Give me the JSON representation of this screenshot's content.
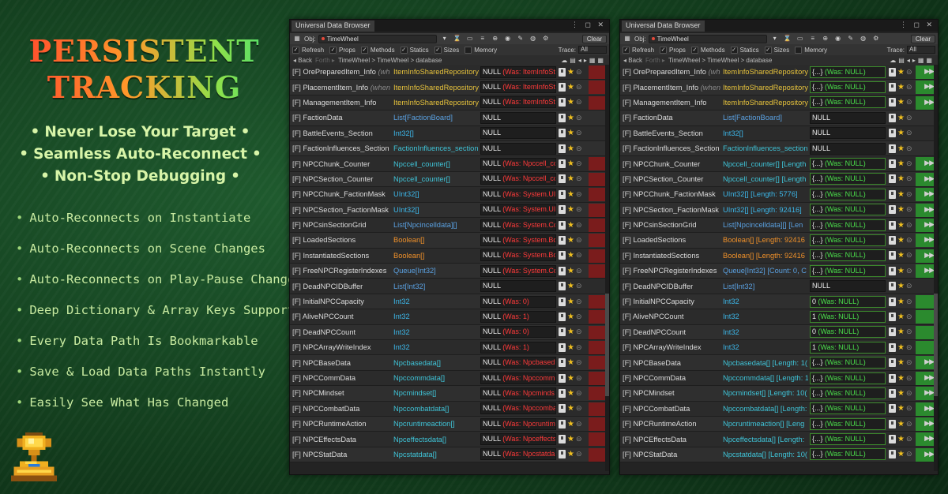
{
  "promo": {
    "title_line1": "PERSISTENT",
    "title_line2": "TRACKING",
    "taglines": [
      "Never Lose Your Target",
      "Seamless Auto-Reconnect",
      "Non-Stop Debugging"
    ],
    "tagline_bullet": "•",
    "features": [
      "Auto-Reconnects on Instantiate",
      "Auto-Reconnects on Scene Changes",
      "Auto-Reconnects on Play-Pause Changes",
      "Deep Dictionary & Array Keys Support",
      "Every Data Path Is Bookmarkable",
      "Save & Load Data Paths Instantly",
      "Easily See What Has Changed"
    ],
    "feature_bullet": "•"
  },
  "window": {
    "tab_title": "Universal Data Browser",
    "obj_label": "Obj:",
    "obj_value": "TimeWheel",
    "clear_label": "Clear",
    "options": [
      "Refresh",
      "Props",
      "Methods",
      "Statics",
      "Sizes",
      "Memory"
    ],
    "options_checked": [
      true,
      true,
      true,
      true,
      true,
      false
    ],
    "trace_label": "Trace:",
    "trace_value": "All",
    "back_label": "◂ Back",
    "forward_label": "Forth ▸",
    "breadcrumb": [
      "TimeWheel",
      "TimeWheel",
      "database"
    ],
    "breadcrumb_sep": ">"
  },
  "colors": {
    "was_red": "#ff3a3a",
    "was_green": "#4be04b",
    "highlight_red": "#7a1c1c",
    "highlight_green": "#2b8a2e"
  },
  "left_rows": [
    {
      "f": "[F]",
      "name": "OrePreparedItem_Info",
      "hint": "(wh",
      "type": "ItemInfoSharedRepository",
      "tc": "t-yellow",
      "val": "NULL",
      "was": "(Was: ItemInfoSt",
      "hl": true
    },
    {
      "f": "[F]",
      "name": "PlacementItem_Info",
      "hint": "(when",
      "type": "ItemInfoSharedRepository",
      "tc": "t-yellow",
      "val": "NULL",
      "was": "(Was: ItemInfoSt",
      "hl": true
    },
    {
      "f": "[F]",
      "name": "ManagementItem_Info",
      "hint": "",
      "type": "ItemInfoSharedRepository",
      "tc": "t-yellow",
      "val": "NULL",
      "was": "(Was: ItemInfoSt",
      "hl": true
    },
    {
      "f": "[F]",
      "name": "FactionData",
      "hint": "",
      "type": "List[FactionBoard]",
      "tc": "t-blue",
      "val": "NULL",
      "was": "",
      "hl": false
    },
    {
      "f": "[F]",
      "name": "BattleEvents_Section",
      "hint": "",
      "type": "Int32[]",
      "tc": "t-cyanb",
      "val": "NULL",
      "was": "",
      "hl": false
    },
    {
      "f": "[F]",
      "name": "FactionInfluences_Section",
      "hint": "",
      "type": "FactionInfluences_section",
      "tc": "t-cyan",
      "val": "NULL",
      "was": "",
      "hl": false
    },
    {
      "f": "[F]",
      "name": "NPCChunk_Counter",
      "hint": "",
      "type": "Npccell_counter[]",
      "tc": "t-cyan",
      "val": "NULL",
      "was": "(Was: Npccell_cc",
      "hl": true
    },
    {
      "f": "[F]",
      "name": "NPCSection_Counter",
      "hint": "",
      "type": "Npccell_counter[]",
      "tc": "t-cyan",
      "val": "NULL",
      "was": "(Was: Npccell_cc",
      "hl": true
    },
    {
      "f": "[F]",
      "name": "NPCChunk_FactionMask",
      "hint": "",
      "type": "UInt32[]",
      "tc": "t-cyanb",
      "val": "NULL",
      "was": "(Was: System.UI",
      "hl": true
    },
    {
      "f": "[F]",
      "name": "NPCSection_FactionMask",
      "hint": "",
      "type": "UInt32[]",
      "tc": "t-cyanb",
      "val": "NULL",
      "was": "(Was: System.UI",
      "hl": true
    },
    {
      "f": "[F]",
      "name": "NPCsinSectionGrid",
      "hint": "",
      "type": "List[Npcincelldata][]",
      "tc": "t-blue",
      "val": "NULL",
      "was": "(Was: System.Co",
      "hl": true
    },
    {
      "f": "[F]",
      "name": "LoadedSections",
      "hint": "",
      "type": "Boolean[]",
      "tc": "t-orange",
      "val": "NULL",
      "was": "(Was: System.Bo",
      "hl": true
    },
    {
      "f": "[F]",
      "name": "InstantiatedSections",
      "hint": "",
      "type": "Boolean[]",
      "tc": "t-orange",
      "val": "NULL",
      "was": "(Was: System.Bo",
      "hl": true
    },
    {
      "f": "[F]",
      "name": "FreeNPCRegisterIndexes",
      "hint": "",
      "type": "Queue[Int32]",
      "tc": "t-blue",
      "val": "NULL",
      "was": "(Was: System.Co",
      "hl": true
    },
    {
      "f": "[F]",
      "name": "DeadNPCIDBuffer",
      "hint": "",
      "type": "List[Int32]",
      "tc": "t-blue",
      "val": "NULL",
      "was": "",
      "hl": false
    },
    {
      "f": "[F]",
      "name": "InitialNPCCapacity",
      "hint": "",
      "type": "Int32",
      "tc": "t-cyanb",
      "val": "NULL",
      "was": "(Was: 0)",
      "hl": true
    },
    {
      "f": "[F]",
      "name": "AliveNPCCount",
      "hint": "",
      "type": "Int32",
      "tc": "t-cyanb",
      "val": "NULL",
      "was": "(Was: 1)",
      "hl": true
    },
    {
      "f": "[F]",
      "name": "DeadNPCCount",
      "hint": "",
      "type": "Int32",
      "tc": "t-cyanb",
      "val": "NULL",
      "was": "(Was: 0)",
      "hl": true
    },
    {
      "f": "[F]",
      "name": "NPCArrayWriteIndex",
      "hint": "",
      "type": "Int32",
      "tc": "t-cyanb",
      "val": "NULL",
      "was": "(Was: 1)",
      "hl": true
    },
    {
      "f": "[F]",
      "name": "NPCBaseData",
      "hint": "",
      "type": "Npcbasedata[]",
      "tc": "t-cyan",
      "val": "NULL",
      "was": "(Was: Npcbased",
      "hl": true
    },
    {
      "f": "[F]",
      "name": "NPCCommData",
      "hint": "",
      "type": "Npccommdata[]",
      "tc": "t-cyan",
      "val": "NULL",
      "was": "(Was: Npccomm",
      "hl": true
    },
    {
      "f": "[F]",
      "name": "NPCMindset",
      "hint": "",
      "type": "Npcmindset[]",
      "tc": "t-cyan",
      "val": "NULL",
      "was": "(Was: Npcminds",
      "hl": true
    },
    {
      "f": "[F]",
      "name": "NPCCombatData",
      "hint": "",
      "type": "Npccombatdata[]",
      "tc": "t-cyan",
      "val": "NULL",
      "was": "(Was: Npccomba",
      "hl": true
    },
    {
      "f": "[F]",
      "name": "NPCRuntimeAction",
      "hint": "",
      "type": "Npcruntimeaction[]",
      "tc": "t-cyan",
      "val": "NULL",
      "was": "(Was: Npcruntim",
      "hl": true
    },
    {
      "f": "[F]",
      "name": "NPCEffectsData",
      "hint": "",
      "type": "Npceffectsdata[]",
      "tc": "t-cyan",
      "val": "NULL",
      "was": "(Was: Npceffects",
      "hl": true
    },
    {
      "f": "[F]",
      "name": "NPCStatData",
      "hint": "",
      "type": "Npcstatdata[]",
      "tc": "t-cyan",
      "val": "NULL",
      "was": "(Was: Npcstatda",
      "hl": true
    }
  ],
  "right_rows": [
    {
      "f": "[F]",
      "name": "OrePreparedItem_Info",
      "hint": "(wh",
      "type": "ItemInfoSharedRepository",
      "tc": "t-yellow",
      "val": "{...}",
      "was": "(Was: NULL)",
      "hl": true,
      "play": true
    },
    {
      "f": "[F]",
      "name": "PlacementItem_Info",
      "hint": "(when",
      "type": "ItemInfoSharedRepository",
      "tc": "t-yellow",
      "val": "{...}",
      "was": "(Was: NULL)",
      "hl": true,
      "play": true
    },
    {
      "f": "[F]",
      "name": "ManagementItem_Info",
      "hint": "",
      "type": "ItemInfoSharedRepository",
      "tc": "t-yellow",
      "val": "{...}",
      "was": "(Was: NULL)",
      "hl": true,
      "play": true
    },
    {
      "f": "[F]",
      "name": "FactionData",
      "hint": "",
      "type": "List[FactionBoard]",
      "tc": "t-blue",
      "val": "NULL",
      "was": "",
      "hl": false,
      "play": false
    },
    {
      "f": "[F]",
      "name": "BattleEvents_Section",
      "hint": "",
      "type": "Int32[]",
      "tc": "t-cyanb",
      "val": "NULL",
      "was": "",
      "hl": false,
      "play": false
    },
    {
      "f": "[F]",
      "name": "FactionInfluences_Section",
      "hint": "",
      "type": "FactionInfluences_section",
      "tc": "t-cyan",
      "val": "NULL",
      "was": "",
      "hl": false,
      "play": false
    },
    {
      "f": "[F]",
      "name": "NPCChunk_Counter",
      "hint": "",
      "type": "Npccell_counter[] [Length",
      "tc": "t-cyan",
      "val": "{...}",
      "was": "(Was: NULL)",
      "hl": true,
      "play": true
    },
    {
      "f": "[F]",
      "name": "NPCSection_Counter",
      "hint": "",
      "type": "Npccell_counter[] [Length",
      "tc": "t-cyan",
      "val": "{...}",
      "was": "(Was: NULL)",
      "hl": true,
      "play": true
    },
    {
      "f": "[F]",
      "name": "NPCChunk_FactionMask",
      "hint": "",
      "type": "UInt32[] [Length: 5776]",
      "tc": "t-cyanb",
      "val": "{...}",
      "was": "(Was: NULL)",
      "hl": true,
      "play": true
    },
    {
      "f": "[F]",
      "name": "NPCSection_FactionMask",
      "hint": "",
      "type": "UInt32[] [Length: 92416]",
      "tc": "t-cyanb",
      "val": "{...}",
      "was": "(Was: NULL)",
      "hl": true,
      "play": true
    },
    {
      "f": "[F]",
      "name": "NPCsinSectionGrid",
      "hint": "",
      "type": "List[Npcincelldata][] [Len",
      "tc": "t-blue",
      "val": "{...}",
      "was": "(Was: NULL)",
      "hl": true,
      "play": true
    },
    {
      "f": "[F]",
      "name": "LoadedSections",
      "hint": "",
      "type": "Boolean[] [Length: 92416",
      "tc": "t-orange",
      "val": "{...}",
      "was": "(Was: NULL)",
      "hl": true,
      "play": true
    },
    {
      "f": "[F]",
      "name": "InstantiatedSections",
      "hint": "",
      "type": "Boolean[] [Length: 92416",
      "tc": "t-orange",
      "val": "{...}",
      "was": "(Was: NULL)",
      "hl": true,
      "play": true
    },
    {
      "f": "[F]",
      "name": "FreeNPCRegisterIndexes",
      "hint": "",
      "type": "Queue[Int32] [Count: 0, C",
      "tc": "t-blue",
      "val": "{...}",
      "was": "(Was: NULL)",
      "hl": true,
      "play": true
    },
    {
      "f": "[F]",
      "name": "DeadNPCIDBuffer",
      "hint": "",
      "type": "List[Int32]",
      "tc": "t-blue",
      "val": "NULL",
      "was": "",
      "hl": false,
      "play": false
    },
    {
      "f": "[F]",
      "name": "InitialNPCCapacity",
      "hint": "",
      "type": "Int32",
      "tc": "t-cyanb",
      "val": "0",
      "was": "(Was: NULL)",
      "hl": true,
      "play": false
    },
    {
      "f": "[F]",
      "name": "AliveNPCCount",
      "hint": "",
      "type": "Int32",
      "tc": "t-cyanb",
      "val": "1",
      "was": "(Was: NULL)",
      "hl": true,
      "play": false
    },
    {
      "f": "[F]",
      "name": "DeadNPCCount",
      "hint": "",
      "type": "Int32",
      "tc": "t-cyanb",
      "val": "0",
      "was": "(Was: NULL)",
      "hl": true,
      "play": false
    },
    {
      "f": "[F]",
      "name": "NPCArrayWriteIndex",
      "hint": "",
      "type": "Int32",
      "tc": "t-cyanb",
      "val": "1",
      "was": "(Was: NULL)",
      "hl": true,
      "play": false
    },
    {
      "f": "[F]",
      "name": "NPCBaseData",
      "hint": "",
      "type": "Npcbasedata[] [Length: 1(",
      "tc": "t-cyan",
      "val": "{...}",
      "was": "(Was: NULL)",
      "hl": true,
      "play": true
    },
    {
      "f": "[F]",
      "name": "NPCCommData",
      "hint": "",
      "type": "Npccommdata[] [Length: 1",
      "tc": "t-cyan",
      "val": "{...}",
      "was": "(Was: NULL)",
      "hl": true,
      "play": true
    },
    {
      "f": "[F]",
      "name": "NPCMindset",
      "hint": "",
      "type": "Npcmindset[] [Length: 10(",
      "tc": "t-cyan",
      "val": "{...}",
      "was": "(Was: NULL)",
      "hl": true,
      "play": true
    },
    {
      "f": "[F]",
      "name": "NPCCombatData",
      "hint": "",
      "type": "Npccombatdata[] [Length: 1",
      "tc": "t-cyan",
      "val": "{...}",
      "was": "(Was: NULL)",
      "hl": true,
      "play": true
    },
    {
      "f": "[F]",
      "name": "NPCRuntimeAction",
      "hint": "",
      "type": "Npcruntimeaction[] [Leng",
      "tc": "t-cyan",
      "val": "{...}",
      "was": "(Was: NULL)",
      "hl": true,
      "play": true
    },
    {
      "f": "[F]",
      "name": "NPCEffectsData",
      "hint": "",
      "type": "Npceffectsdata[] [Length:",
      "tc": "t-cyan",
      "val": "{...}",
      "was": "(Was: NULL)",
      "hl": true,
      "play": true
    },
    {
      "f": "[F]",
      "name": "NPCStatData",
      "hint": "",
      "type": "Npcstatdata[] [Length: 10(",
      "tc": "t-cyan",
      "val": "{...}",
      "was": "(Was: NULL)",
      "hl": true,
      "play": true
    }
  ]
}
